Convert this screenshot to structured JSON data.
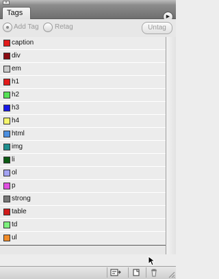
{
  "panel": {
    "tab_label": "Tags"
  },
  "options": {
    "add_tag_label": "Add Tag",
    "retag_label": "Retag",
    "untag_label": "Untag"
  },
  "tags": [
    {
      "label": "caption",
      "color": "#e31b1b"
    },
    {
      "label": "div",
      "color": "#8b0d14"
    },
    {
      "label": "em",
      "color": "#c9c9c9"
    },
    {
      "label": "h1",
      "color": "#e31b1b"
    },
    {
      "label": "h2",
      "color": "#55e055"
    },
    {
      "label": "h3",
      "color": "#1717e6"
    },
    {
      "label": "h4",
      "color": "#f5f56c"
    },
    {
      "label": "html",
      "color": "#4c8fe0"
    },
    {
      "label": "img",
      "color": "#1f8f8f"
    },
    {
      "label": "li",
      "color": "#0b5a12"
    },
    {
      "label": "ol",
      "color": "#a3a3f2"
    },
    {
      "label": "p",
      "color": "#e050e0"
    },
    {
      "label": "strong",
      "color": "#777777"
    },
    {
      "label": "table",
      "color": "#d11b1b"
    },
    {
      "label": "td",
      "color": "#7ef07e"
    },
    {
      "label": "ul",
      "color": "#f08c2a"
    }
  ],
  "toolbar": {
    "icons": [
      "new-tag-from-selection-icon",
      "new-tag-icon",
      "delete-tag-icon"
    ]
  }
}
